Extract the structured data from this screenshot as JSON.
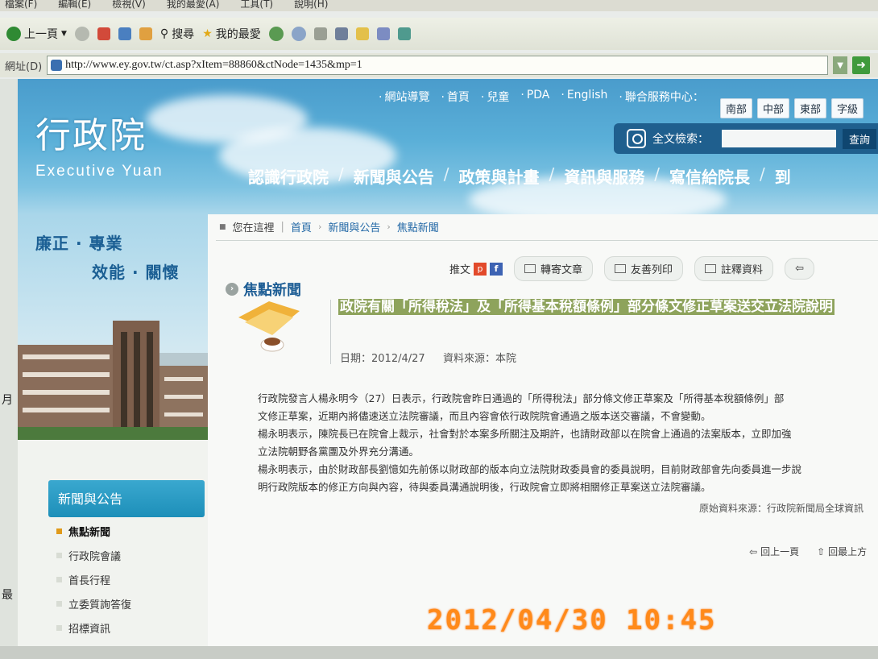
{
  "browser": {
    "menu_items": [
      "檔案(F)",
      "編輯(E)",
      "檢視(V)",
      "我的最愛(A)",
      "工具(T)",
      "說明(H)"
    ],
    "back_label": "上一頁",
    "search_label": "搜尋",
    "favorites_label": "我的最愛",
    "address_label": "網址(D)",
    "url": "http://www.ey.gov.tw/ct.asp?xItem=88860&ctNode=1435&mp=1"
  },
  "header": {
    "logo_cn": "行政院",
    "logo_en": "Executive Yuan",
    "top_links": [
      "網站導覽",
      "首頁",
      "兒童",
      "PDA",
      "English",
      "聯合服務中心："
    ],
    "regions": [
      "南部",
      "中部",
      "東部",
      "字級"
    ],
    "search_label": "全文檢索：",
    "search_button": "查詢",
    "main_nav": [
      "認識行政院",
      "新聞與公告",
      "政策與計畫",
      "資訊與服務",
      "寫信給院長",
      "到"
    ]
  },
  "sidebar": {
    "slogan_line1": "廉正 · 專業",
    "slogan_line2": "效能 · 關懷",
    "nav_title": "新聞與公告",
    "items": [
      "焦點新聞",
      "行政院會議",
      "首長行程",
      "立委質詢答復",
      "招標資訊"
    ]
  },
  "content": {
    "breadcrumb_label": "您在這裡",
    "breadcrumb": [
      "首頁",
      "新聞與公告",
      "焦點新聞"
    ],
    "share_label": "推文",
    "actions": [
      "轉寄文章",
      "友善列印",
      "註釋資料"
    ],
    "section_title": "焦點新聞",
    "headline": "政院有關「所得稅法」及「所得基本稅額條例」部分條文修正草案送交立法院說明",
    "date_label": "日期：2012/4/27",
    "source_label": "資料來源：本院",
    "paragraphs": [
      "行政院發言人楊永明今（27）日表示，行政院會昨日通過的「所得稅法」部分條文修正草案及「所得基本稅額條例」部",
      "文修正草案，近期內將儘速送立法院審議，而且內容會依行政院院會通過之版本送交審議，不會變動。",
      "楊永明表示，陳院長已在院會上裁示，社會對於本案多所關注及期許，也請財政部以在院會上通過的法案版本，立即加強",
      "立法院朝野各黨團及外界充分溝通。",
      "楊永明表示，由於財政部長劉憶如先前係以財政部的版本向立法院財政委員會的委員說明，目前財政部會先向委員進一步說",
      "明行政院版本的修正方向與內容，待與委員溝通說明後，行政院會立即將相關修正草案送立法院審議。"
    ],
    "original_source": "原始資料來源：行政院新聞局全球資訊",
    "bottom_links": [
      "回上一頁",
      "回最上方"
    ]
  },
  "camera": {
    "timestamp": "2012/04/30 10:45"
  },
  "left_fragments": [
    "月",
    "最"
  ]
}
